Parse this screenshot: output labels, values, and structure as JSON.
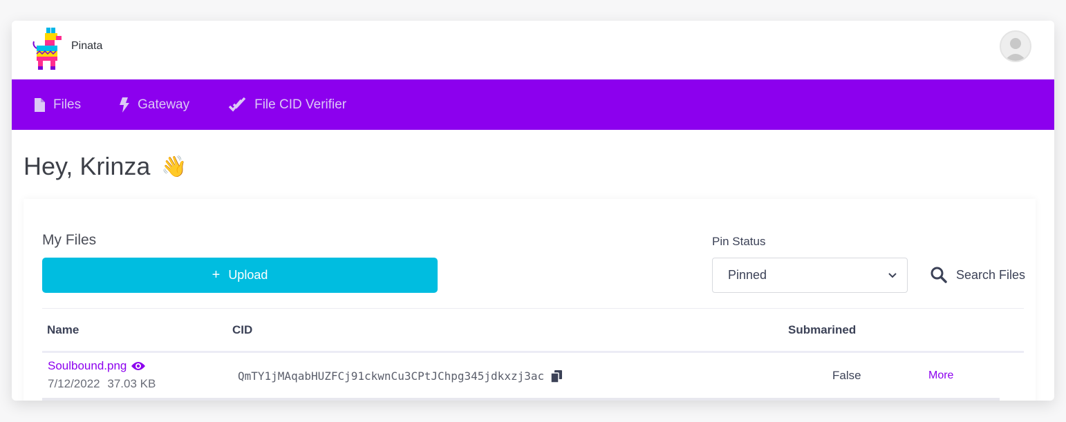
{
  "app": {
    "title": "Pinata"
  },
  "nav": {
    "items": [
      {
        "label": "Files",
        "icon": "file-icon"
      },
      {
        "label": "Gateway",
        "icon": "bolt-icon"
      },
      {
        "label": "File CID Verifier",
        "icon": "double-check-icon"
      }
    ]
  },
  "greeting": {
    "text": "Hey, Krinza",
    "emoji": "👋"
  },
  "files": {
    "title": "My Files",
    "upload_label": "Upload",
    "pin_status_label": "Pin Status",
    "pin_status_value": "Pinned",
    "search_label": "Search Files",
    "columns": {
      "name": "Name",
      "cid": "CID",
      "submarined": "Submarined"
    },
    "rows": [
      {
        "name": "Soulbound.png",
        "date": "7/12/2022",
        "size": "37.03 KB",
        "cid": "QmTY1jMAqabHUZFCj91ckwnCu3CPtJChpg345jdkxzj3ac",
        "submarined": "False",
        "action": "More"
      }
    ]
  },
  "colors": {
    "accent": "#8c00ee",
    "upload": "#00bde0"
  }
}
